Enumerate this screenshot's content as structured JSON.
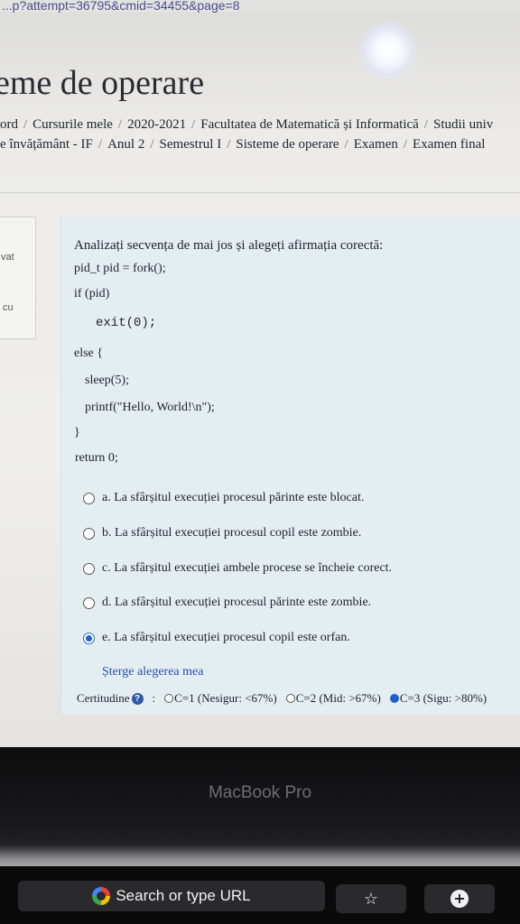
{
  "browser": {
    "url_fragment": "...p?attempt=36795&cmid=34455&page=8"
  },
  "page": {
    "title": "eme de operare"
  },
  "breadcrumb": {
    "line1": [
      "ord",
      "Cursurile mele",
      "2020-2021",
      "Facultatea de Matematică și Informatică",
      "Studii univ"
    ],
    "line2": [
      "e învățământ - IF",
      "Anul 2",
      "Semestrul I",
      "Sisteme de operare",
      "Examen",
      "Examen final"
    ]
  },
  "left_panel": {
    "text1": "vat",
    "text2": "cu"
  },
  "question": {
    "intro": "Analizați secvența de mai jos și alegeți afirmația corectă:",
    "code": [
      "pid_t pid = fork();",
      "if (pid)",
      "exit(0);",
      "else {",
      "sleep(5);",
      "printf(\"Hello, World!\\n\");",
      "}",
      "return 0;"
    ],
    "answers": [
      {
        "label": "a. La sfârșitul execuției procesul părinte este blocat.",
        "checked": false
      },
      {
        "label": "b. La sfârșitul execuției procesul copil este zombie.",
        "checked": false
      },
      {
        "label": "c. La sfârșitul execuției ambele procese se încheie corect.",
        "checked": false
      },
      {
        "label": "d. La sfârșitul execuției procesul părinte este zombie.",
        "checked": false
      },
      {
        "label": "e. La sfârșitul execuției procesul copil este orfan.",
        "checked": true
      }
    ],
    "clear_choice": "Șterge alegerea mea",
    "certitude": {
      "label": "Certitudine",
      "separator": ":",
      "options": [
        {
          "label": "C=1 (Nesigur: <67%)",
          "checked": false
        },
        {
          "label": "C=2 (Mid: >67%)",
          "checked": false
        },
        {
          "label": "C=3 (Sigu: >80%)",
          "checked": true
        }
      ]
    }
  },
  "device": {
    "bezel_label": "MacBook Pro"
  },
  "touchbar": {
    "search_label": "Search or type URL",
    "icons": [
      "google-icon",
      "star-icon",
      "plus-circle-icon"
    ]
  }
}
